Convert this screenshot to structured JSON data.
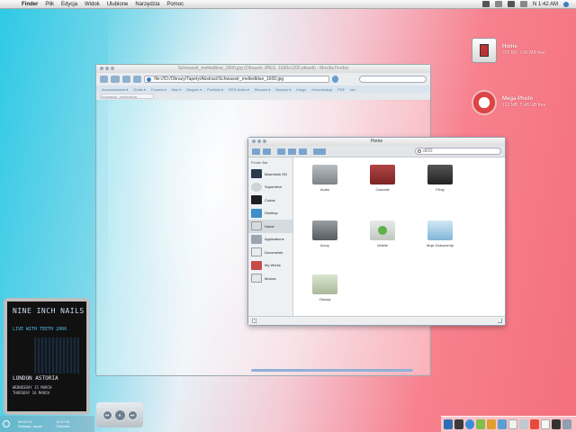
{
  "menubar": {
    "apple": "",
    "items": [
      "Finder",
      "Plik",
      "Edycja",
      "Widok",
      "Ulubione",
      "Narzędzia",
      "Pomoc"
    ],
    "clock": "N 1:42 AM"
  },
  "desktop_icons": [
    {
      "name": "Home",
      "sub": "370 KB, 7.66 MB free"
    },
    {
      "name": "Mega Photo",
      "sub": "102 MB, 5.48 GB free"
    }
  ],
  "browser": {
    "title": "Schwasstr_meltedblue_1600.jpg (Obrazek JPEG, 1600x1200 pikseli) - Mozilla Firefox",
    "url": "file:///D:/Obrazy/Tapety/Abstract/Schwasstr_meltedblue_1600.jpg",
    "bookmarks": [
      "Accessoriabsd ▾",
      "Grafis ▾",
      "Forums ▾",
      "Mac ▾",
      "Blogare ▾",
      "Portfolio ▾",
      "RSS Nokia ▾",
      "Stocons ▾",
      "Muzkoo ▾",
      "Inlogo",
      "Komunixacja",
      "PDF",
      "iart"
    ],
    "tab": "Schwasstr_meltedblue..."
  },
  "finder": {
    "title": "Home",
    "search_placeholder": "dOO",
    "sidebar_header": "Finder Bar",
    "sidebar": [
      {
        "label": "Macintosh HD",
        "color": "#2b3a4a"
      },
      {
        "label": "Superdrive",
        "color": "#cfd3d7"
      },
      {
        "label": "Codas",
        "color": "#1f1f1f"
      },
      {
        "label": "Desktop",
        "color": "#3d8fc8"
      },
      {
        "label": "Home",
        "color": "#d8dbde"
      },
      {
        "label": "Applications",
        "color": "#9aa5b0"
      },
      {
        "label": "Documents",
        "color": "#e9ecef"
      },
      {
        "label": "My Works",
        "color": "#c84b4b"
      },
      {
        "label": "Movies",
        "color": "#e4e6e8"
      }
    ],
    "items": [
      {
        "label": "Audio",
        "color": "#8f9599"
      },
      {
        "label": "Czcionki",
        "color": "#8c2f2f"
      },
      {
        "label": "Filmy",
        "color": "#3a3a3a"
      },
      {
        "label": "Ikony",
        "color": "#6f7478"
      },
      {
        "label": "Vetelle",
        "color": "#5fb24a"
      },
      {
        "label": "Moje Dokumenty",
        "color": "#7fb6d8"
      },
      {
        "label": "Obrazy",
        "color": "#b8c7a8"
      }
    ]
  },
  "poster": {
    "band": "NINE INCH NAILS",
    "tour": "LIVE WITH TEETH 2006",
    "venue": "LONDON ASTORIA",
    "date1": "WEDNESDAY 15 MARCH",
    "date2": "THURSDAY 16 MARCH"
  },
  "clocks": [
    {
      "time": "06:42:41",
      "city": "Warsaw, Japan"
    },
    {
      "time": "14:17:41",
      "city": "Ceterraf..."
    }
  ],
  "player": {
    "prev": "⏮",
    "play": "⏸",
    "next": "⏭"
  },
  "dock": [
    "#2d6fb5",
    "#3a3a3a",
    "#3c8dd8",
    "#7fbf4a",
    "#e0a030",
    "#5a9fd0",
    "#f0f0f0",
    "#c0c8d0",
    "#e84b3a",
    "#f5f5f5",
    "#333",
    "#8fa0b0"
  ]
}
